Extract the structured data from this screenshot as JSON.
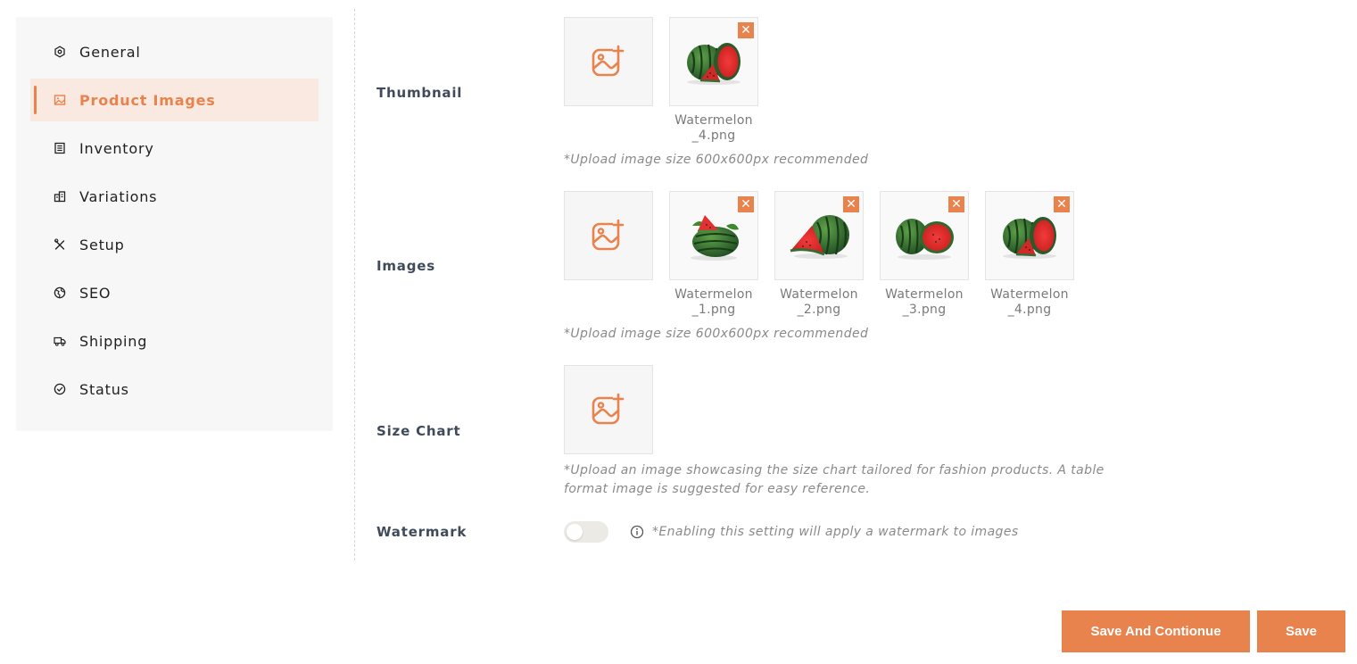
{
  "sidebar": {
    "items": [
      {
        "label": "General",
        "icon": "hexagon-settings-icon",
        "active": false
      },
      {
        "label": "Product Images",
        "icon": "image-icon",
        "active": true
      },
      {
        "label": "Inventory",
        "icon": "list-document-icon",
        "active": false
      },
      {
        "label": "Variations",
        "icon": "building-icon",
        "active": false
      },
      {
        "label": "Setup",
        "icon": "tools-icon",
        "active": false
      },
      {
        "label": "SEO",
        "icon": "globe-icon",
        "active": false
      },
      {
        "label": "Shipping",
        "icon": "truck-icon",
        "active": false
      },
      {
        "label": "Status",
        "icon": "check-circle-icon",
        "active": false
      }
    ]
  },
  "thumbnail": {
    "label": "Thumbnail",
    "files": [
      "Watermelon\n_4.png"
    ],
    "hint": "*Upload image size 600x600px recommended"
  },
  "images": {
    "label": "Images",
    "files": [
      "Watermelon\n_1.png",
      "Watermelon\n_2.png",
      "Watermelon\n_3.png",
      "Watermelon\n_4.png"
    ],
    "hint": "*Upload image size 600x600px recommended"
  },
  "size_chart": {
    "label": "Size Chart",
    "hint": "*Upload an image showcasing the size chart tailored for fashion products. A table format image is suggested for easy reference."
  },
  "watermark": {
    "label": "Watermark",
    "enabled": false,
    "hint": "*Enabling this setting will apply a watermark to images"
  },
  "actions": {
    "save_continue": "Save And Contionue",
    "save": "Save"
  },
  "colors": {
    "accent": "#e8834d",
    "active_bg": "#f9e9e0",
    "sidebar_bg": "#f7f7f7",
    "label": "#3f4a5a"
  },
  "remove_glyph": "✕"
}
